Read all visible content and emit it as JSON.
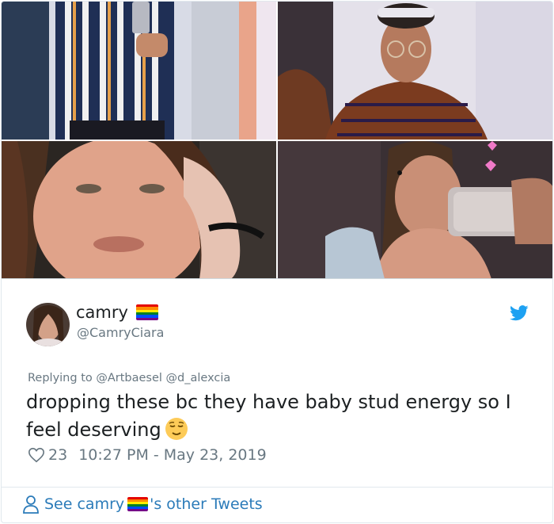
{
  "user": {
    "display_name": "camry",
    "handle": "@CamryCiara"
  },
  "reply_to": {
    "prefix": "Replying to",
    "mentions": "@Artbaesel @d_alexcia"
  },
  "tweet": {
    "text": "dropping these bc they have baby stud energy so I feel deserving"
  },
  "meta": {
    "likes": "23",
    "timestamp": "10:27 PM - May 23, 2019"
  },
  "footer": {
    "prefix": "See camry",
    "suffix": "'s other Tweets"
  },
  "icons": {
    "brand": "twitter-bird-icon",
    "emoji": "relieved-face-emoji",
    "flag": "rainbow-flag-emoji",
    "like": "heart-outline-icon",
    "profile": "person-outline-icon"
  },
  "colors": {
    "link": "#2b7bb9",
    "secondary_text": "#697882",
    "primary_text": "#1c2022",
    "twitter_blue": "#1da1f2",
    "border": "#e1e8ed"
  }
}
